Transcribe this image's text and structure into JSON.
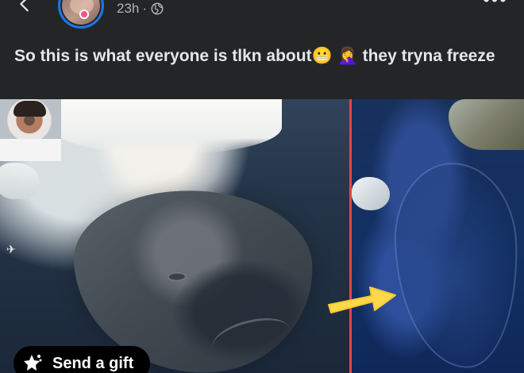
{
  "header": {
    "back_icon": "back-arrow-icon",
    "timestamp": "23h",
    "separator": "·",
    "privacy_icon": "globe-icon",
    "more_icon": "more-options-icon"
  },
  "post": {
    "caption_start": "So this is what everyone is tlkn about",
    "emoji_one": "😬",
    "emoji_two": "🤦‍♀️",
    "caption_end": "they tryna freeze"
  },
  "media": {
    "divider_color": "#e14747",
    "arrow_color": "#ffd84c"
  },
  "actions": {
    "send_gift_label": "Send a gift",
    "gift_icon": "star-gift-icon"
  }
}
